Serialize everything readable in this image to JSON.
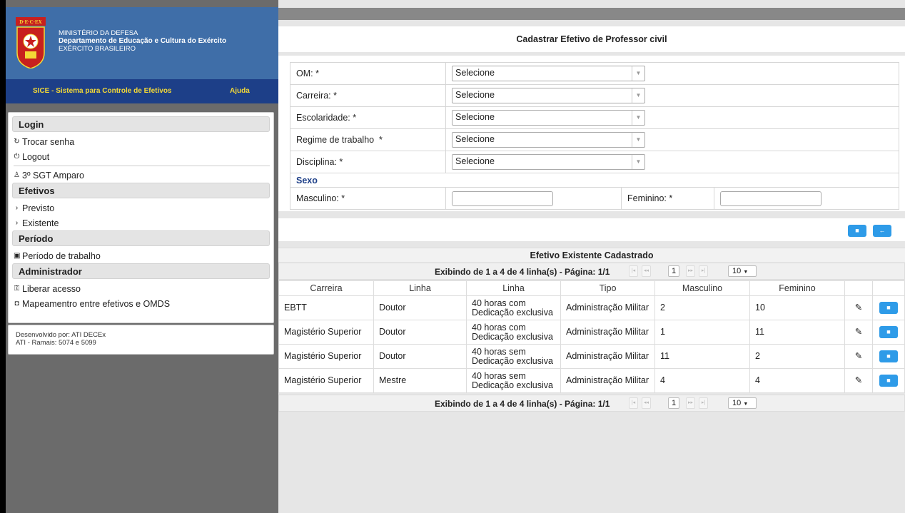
{
  "header": {
    "ministry_line1": "MINISTÉRIO DA DEFESA",
    "ministry_line2": "Departamento de Educação e Cultura do Exército",
    "ministry_line3": "EXÉRCITO BRASILEIRO",
    "logo_text": "D·E·C·EX",
    "system_title": "SICE - Sistema para Controle de Efetivos",
    "help_label": "Ajuda"
  },
  "sidebar": {
    "login_section": "Login",
    "change_password": "Trocar senha",
    "logout": "Logout",
    "user": "3º SGT Amparo",
    "efetivos_section": "Efetivos",
    "previsto": "Previsto",
    "existente": "Existente",
    "periodo_section": "Período",
    "periodo_trabalho": "Período de trabalho",
    "admin_section": "Administrador",
    "liberar_acesso": "Liberar acesso",
    "mapeamento": "Mapeamentro entre efetivos e OMDS",
    "footer_line1": "Desenvolvido por: ATI DECEx",
    "footer_line2": "ATI - Ramais: 5074 e 5099"
  },
  "form": {
    "title": "Cadastrar Efetivo de Professor civil",
    "om_label": "OM: *",
    "om_value": "Selecione",
    "carreira_label": "Carreira: *",
    "carreira_value": "Selecione",
    "escolaridade_label": "Escolaridade: *",
    "escolaridade_value": "Selecione",
    "regime_label": "Regime de trabalho  *",
    "regime_value": "Selecione",
    "disciplina_label": "Disciplina: *",
    "disciplina_value": "Selecione",
    "sexo_label": "Sexo",
    "masculino_label": "Masculino: *",
    "masculino_value": "",
    "feminino_label": "Feminino: *",
    "feminino_value": ""
  },
  "grid": {
    "title": "Efetivo Existente Cadastrado",
    "pager_info": "Exibindo de 1 a 4 de 4 linha(s) - Página: 1/1",
    "current_page": "1",
    "rows_per_page": "10",
    "columns": [
      "Carreira",
      "Linha",
      "Linha",
      "Tipo",
      "Masculino",
      "Feminino"
    ],
    "rows": [
      {
        "carreira": "EBTT",
        "linha": "Doutor",
        "regime": "40 horas com Dedicação exclusiva",
        "tipo": "Administração Militar",
        "masculino": "2",
        "feminino": "10"
      },
      {
        "carreira": "Magistério Superior",
        "linha": "Doutor",
        "regime": "40 horas com Dedicação exclusiva",
        "tipo": "Administração Militar",
        "masculino": "1",
        "feminino": "11"
      },
      {
        "carreira": "Magistério Superior",
        "linha": "Doutor",
        "regime": "40 horas sem Dedicação exclusiva",
        "tipo": "Administração Militar",
        "masculino": "11",
        "feminino": "2"
      },
      {
        "carreira": "Magistério Superior",
        "linha": "Mestre",
        "regime": "40 horas sem Dedicação exclusiva",
        "tipo": "Administração Militar",
        "masculino": "4",
        "feminino": "4"
      }
    ]
  },
  "colors": {
    "header_blue": "#3f6ea8",
    "nav_blue": "#1d3f88",
    "nav_text_yellow": "#f4d936",
    "button_blue": "#2e9be8"
  }
}
